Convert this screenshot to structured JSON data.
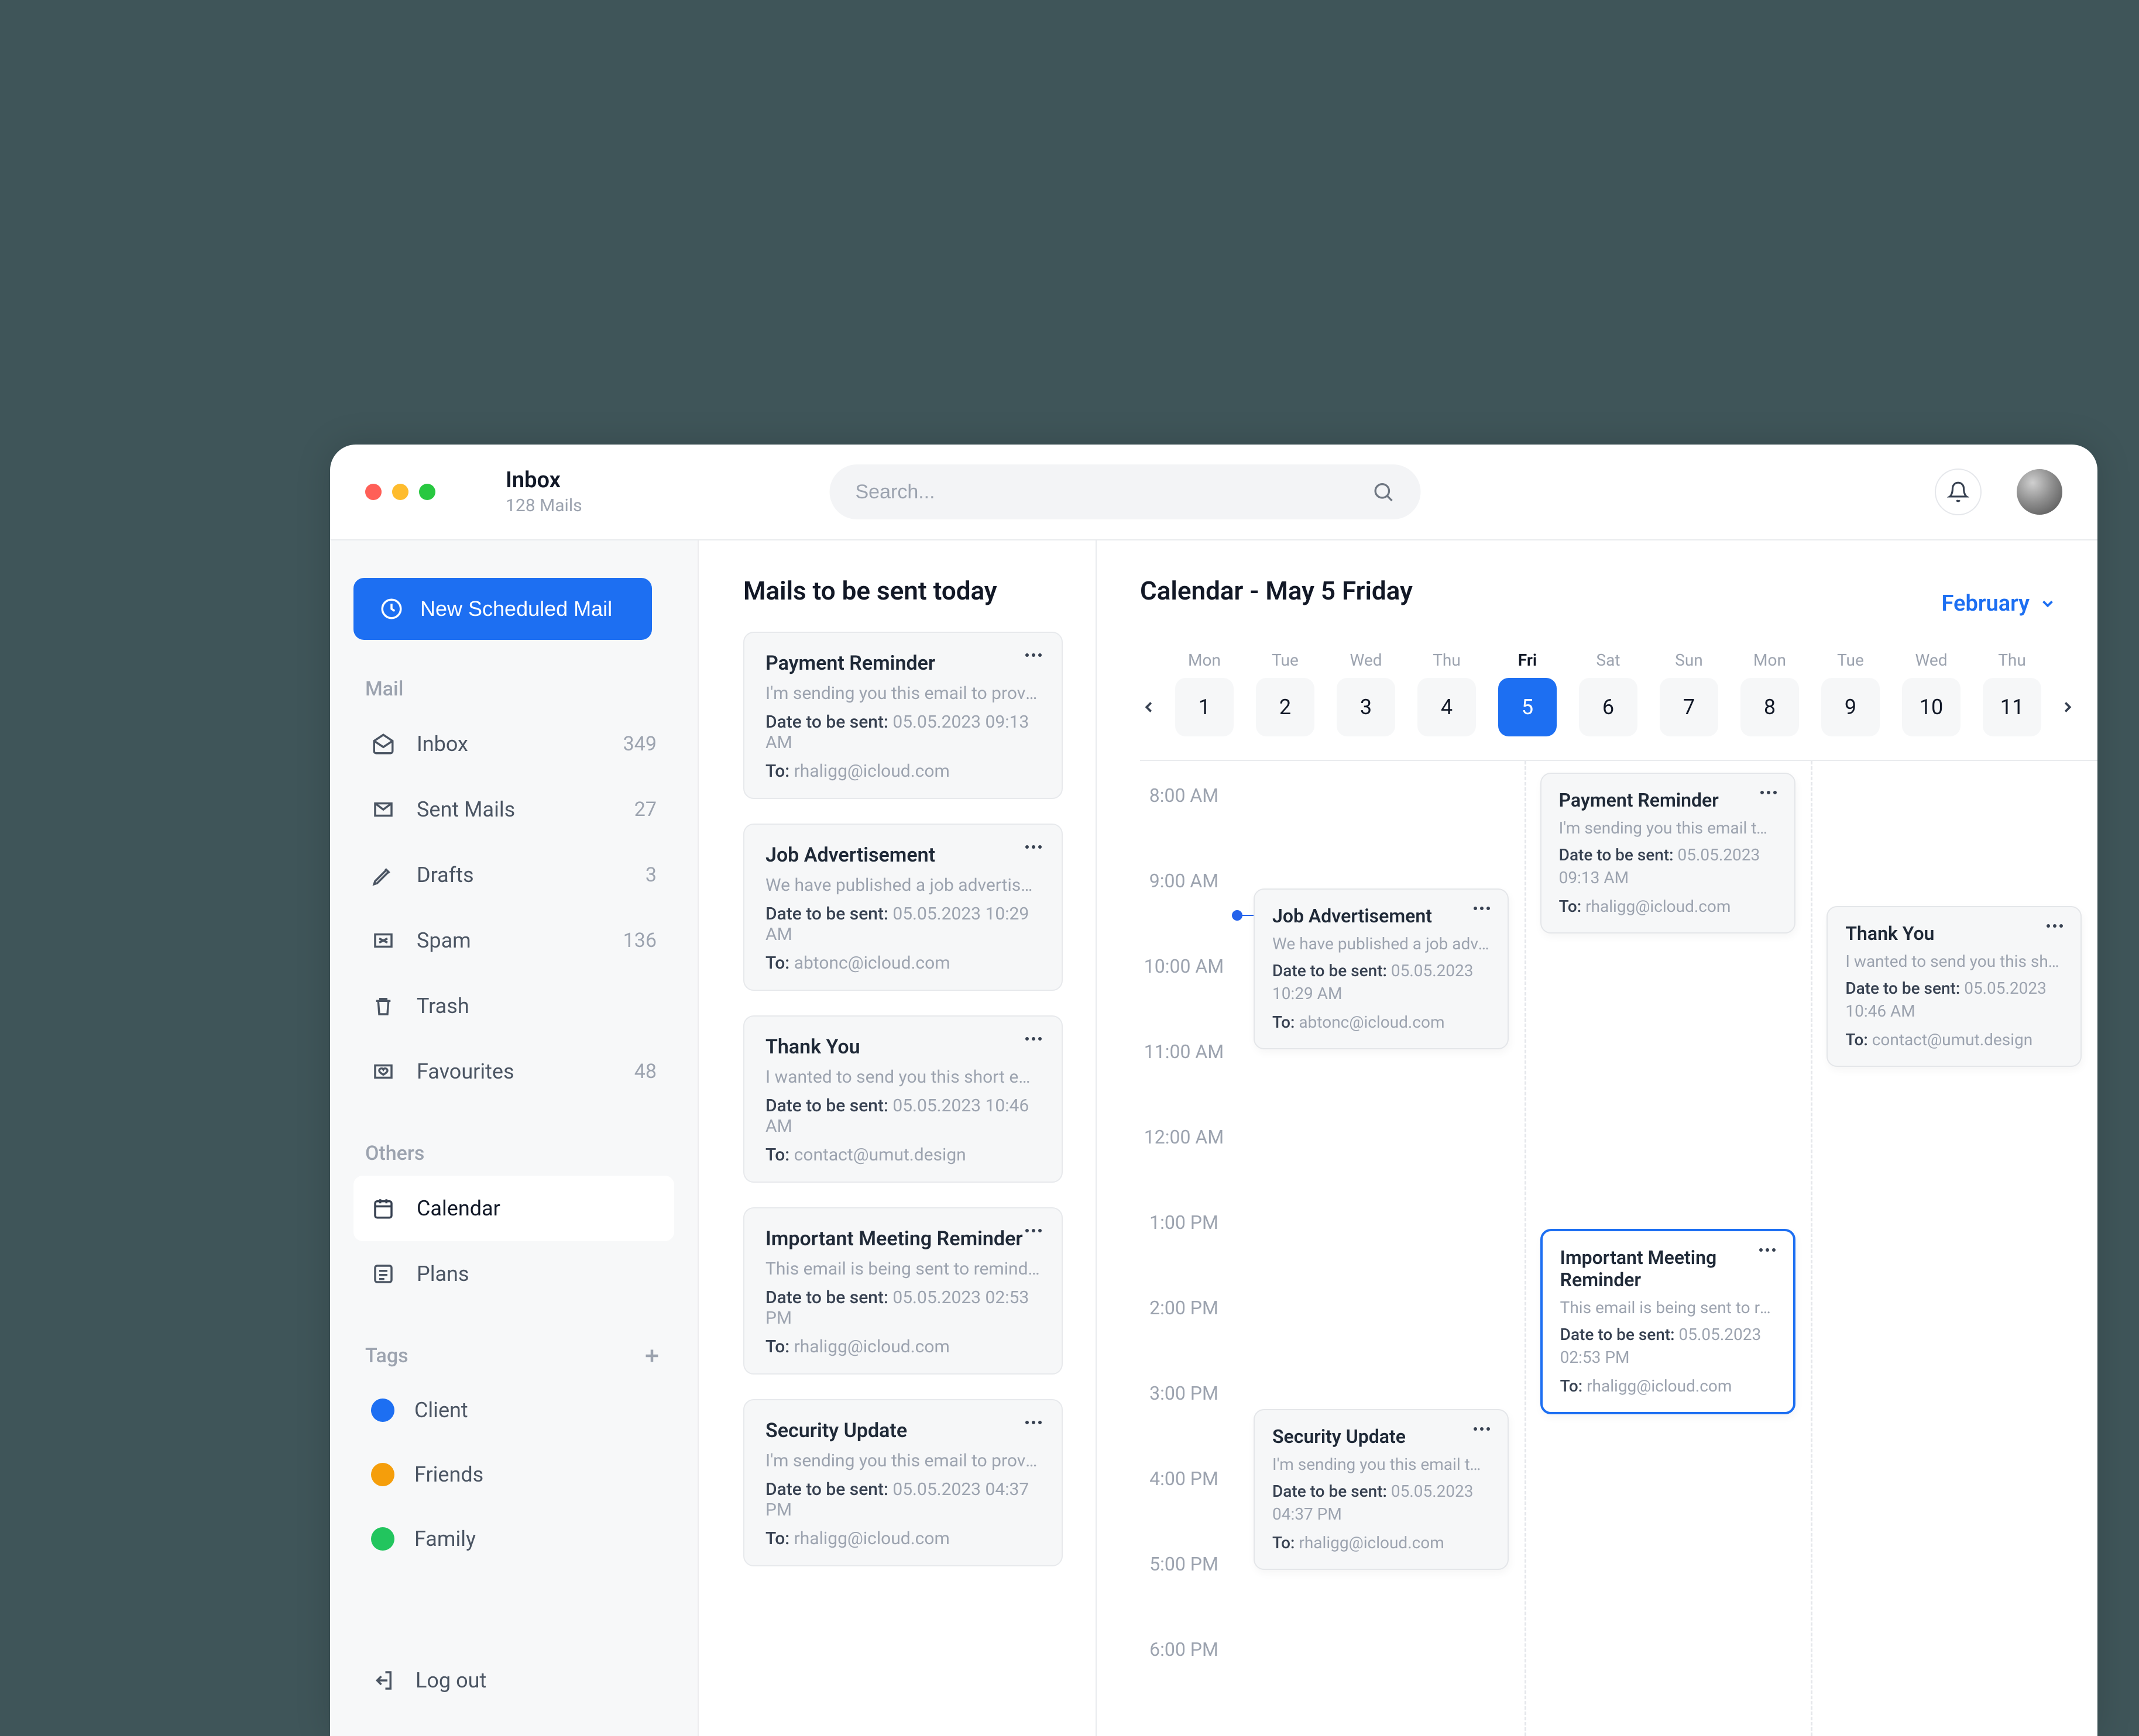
{
  "titlebar": {
    "title": "Inbox",
    "subtitle": "128 Mails",
    "search_placeholder": "Search..."
  },
  "sidebar": {
    "new_button_label": "New Scheduled Mail",
    "section_mail": "Mail",
    "section_others": "Others",
    "section_tags": "Tags",
    "logout_label": "Log out",
    "mail_items": [
      {
        "label": "Inbox",
        "count": "349"
      },
      {
        "label": "Sent Mails",
        "count": "27"
      },
      {
        "label": "Drafts",
        "count": "3"
      },
      {
        "label": "Spam",
        "count": "136"
      },
      {
        "label": "Trash",
        "count": ""
      },
      {
        "label": "Favourites",
        "count": "48"
      }
    ],
    "others_items": [
      {
        "label": "Calendar",
        "active": true
      },
      {
        "label": "Plans",
        "active": false
      }
    ],
    "tags": [
      {
        "label": "Client",
        "color": "tag-blue"
      },
      {
        "label": "Friends",
        "color": "tag-orange"
      },
      {
        "label": "Family",
        "color": "tag-green"
      }
    ]
  },
  "mail_list": {
    "heading": "Mails to be sent today",
    "date_key": "Date to be sent:",
    "to_key": "To:",
    "items": [
      {
        "title": "Payment Reminder",
        "body": "I'm sending you this email to provide...",
        "date": "05.05.2023 09:13 AM",
        "to": "rhaligg@icloud.com"
      },
      {
        "title": "Job Advertisement",
        "body": "We have published a job advertisemen...",
        "date": "05.05.2023 10:29 AM",
        "to": "abtonc@icloud.com"
      },
      {
        "title": "Thank You",
        "body": "I wanted to send you this short email...",
        "date": "05.05.2023 10:46 AM",
        "to": "contact@umut.design"
      },
      {
        "title": "Important Meeting Reminder",
        "body": "This email is being sent to remind you...",
        "date": "05.05.2023 02:53 PM",
        "to": "rhaligg@icloud.com"
      },
      {
        "title": "Security Update",
        "body": "I'm sending you this email to provide...",
        "date": "05.05.2023 04:37 PM",
        "to": "rhaligg@icloud.com"
      }
    ]
  },
  "calendar": {
    "heading": "Calendar - May 5 Friday",
    "month_label": "February",
    "dows": [
      "Mon",
      "Tue",
      "Wed",
      "Thu",
      "Fri",
      "Sat",
      "Sun",
      "Mon",
      "Tue",
      "Wed",
      "Thu"
    ],
    "days": [
      "1",
      "2",
      "3",
      "4",
      "5",
      "6",
      "7",
      "8",
      "9",
      "10",
      "11"
    ],
    "selected_index": 4,
    "time_labels": [
      "8:00 AM",
      "9:00 AM",
      "10:00 AM",
      "11:00 AM",
      "12:00 AM",
      "1:00 PM",
      "2:00 PM",
      "3:00 PM",
      "4:00 PM",
      "5:00 PM",
      "6:00 PM"
    ],
    "date_key": "Date to be sent:",
    "to_key": "To:",
    "events": {
      "job_ad": {
        "title": "Job Advertisement",
        "body": "We have published a job adver...",
        "date": "05.05.2023 10:29 AM",
        "to": "abtonc@icloud.com"
      },
      "security": {
        "title": "Security Update",
        "body": "I'm sending you this email to p...",
        "date": "05.05.2023 04:37 PM",
        "to": "rhaligg@icloud.com"
      },
      "payment": {
        "title": "Payment Reminder",
        "body": "I'm sending you this email to p...",
        "date": "05.05.2023 09:13 AM",
        "to": "rhaligg@icloud.com"
      },
      "meeting": {
        "title": "Important Meeting Reminder",
        "body": "This email is being sent to rem...",
        "date": "05.05.2023 02:53 PM",
        "to": "rhaligg@icloud.com"
      },
      "thankyou": {
        "title": "Thank You",
        "body": "I wanted to send you this shor...",
        "date": "05.05.2023 10:46 AM",
        "to": "contact@umut.design"
      }
    }
  }
}
